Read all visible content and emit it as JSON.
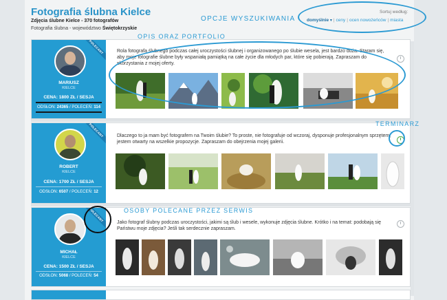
{
  "header": {
    "title": "Fotografia ślubna Kielce",
    "subtitle": "Zdjęcia ślubne Kielce - 370 fotografów",
    "breadcrumb_prefix": "Fotografia ślubna - województwo",
    "breadcrumb_region": "Świętokrzyskie"
  },
  "sort": {
    "label": "Sortuj według:",
    "options": [
      "domyślnie",
      "ceny",
      "ocen nowożeńców",
      "miasta"
    ],
    "selected": "domyślnie"
  },
  "annotations": {
    "search_options": "OPCJE WYSZUKIWANIA",
    "description_portfolio": "OPIS ORAZ PORTFOLIO",
    "calendar": "TERMINARZ",
    "recommended": "OSOBY POLECANE PRZEZ SERWIS"
  },
  "ribbon_text": "POLECANY",
  "photographers": [
    {
      "name": "MARIUSZ",
      "city": "KIELCE",
      "price": "CENA: 1800 ZŁ / SESJA",
      "views_label": "ODSŁON:",
      "views": "24365",
      "recs_label": "POLECEŃ:",
      "recs": "114",
      "description": "Rola fotografa ślubnego podczas całej uroczystości ślubnej i organizowanego po ślubie wesela, jest bardzo duża. Staram się, aby moje fotografie ślubne były wspaniałą pamiątką na całe życie dla młodych par, które się pobierają. Zapraszam do skorzystania z mojej oferty.",
      "calendar": "clock-icon"
    },
    {
      "name": "ROBERT",
      "city": "KIELCE",
      "price": "CENA: 1700 ZŁ / SESJA",
      "views_label": "ODSŁON:",
      "views": "6507",
      "recs_label": "POLECEŃ:",
      "recs": "12",
      "description": "Dlaczego to ja mam być fotografem na Twoim ślubie? To proste, nie fotografuje od wczoraj, dysponuje profesjonalnym sprzętem, jestem otwarty na wszelkie propozycje. Zapraszam do obejrzenia mojej galerii.",
      "calendar": "clock-icon-active"
    },
    {
      "name": "MICHAŁ",
      "city": "KIELCE",
      "price": "CENA: 1500 ZŁ / SESJA",
      "views_label": "ODSŁON:",
      "views": "5068",
      "recs_label": "POLECEŃ:",
      "recs": "54",
      "description": "Jako fotograf ślubny podczas uroczystości, jakimi są ślub i wesele, wykonuje zdjęcia ślubne. Krótko i na temat: podobają się Państwu moje zdjęcia? Jeśli tak serdecznie zapraszam.",
      "calendar": "clock-icon"
    }
  ],
  "colors": {
    "accent": "#2b9ad3",
    "sidebar": "#249cd2",
    "calendar_active": "#4caa44"
  }
}
